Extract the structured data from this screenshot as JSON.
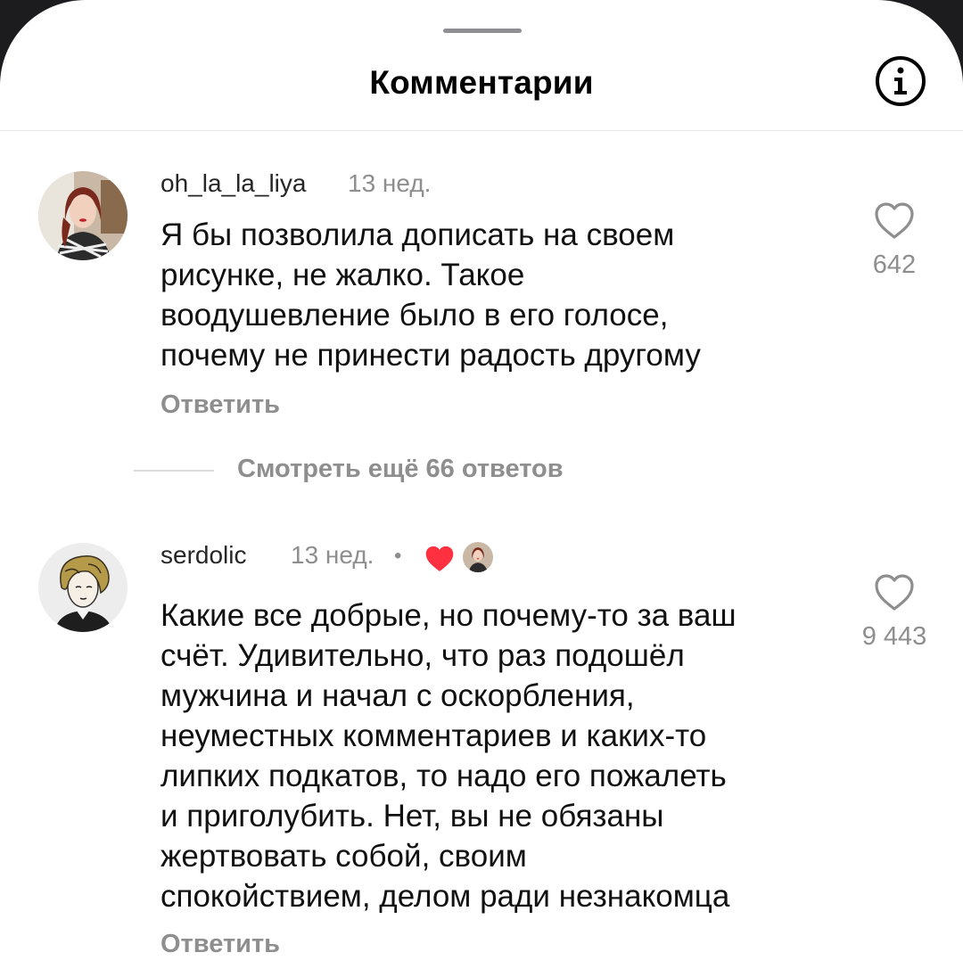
{
  "header": {
    "title": "Комментарии",
    "info_icon": "info-icon"
  },
  "comments": [
    {
      "username": "oh_la_la_liya",
      "time": "13 нед.",
      "text": "Я бы позволила дописать на своем\nрисунке, не жалко. Такое\nвоодушевление было в его голосе,\nпочему не принести радость другому",
      "likes": "642",
      "reply_label": "Ответить",
      "view_more_label": "Смотреть ещё 66 ответов"
    },
    {
      "username": "serdolic",
      "time": "13 нед.",
      "separator": "•",
      "liked_by_author_icon": "heart-icon",
      "text": "Какие все добрые, но почему-то за ваш\nсчёт. Удивительно, что раз подошёл\nмужчина и начал с оскорбления,\nнеуместных комментариев и каких-то\nлипких подкатов, то надо его пожалеть\nи приголубить. Нет, вы не обязаны\nжертвовать собой, своим\nспокойствием, делом ради незнакомца",
      "likes": "9 443",
      "reply_label": "Ответить"
    }
  ],
  "colors": {
    "heart": "#ff3040",
    "secondary_text": "#8e8e8e",
    "primary_text": "#111111"
  }
}
